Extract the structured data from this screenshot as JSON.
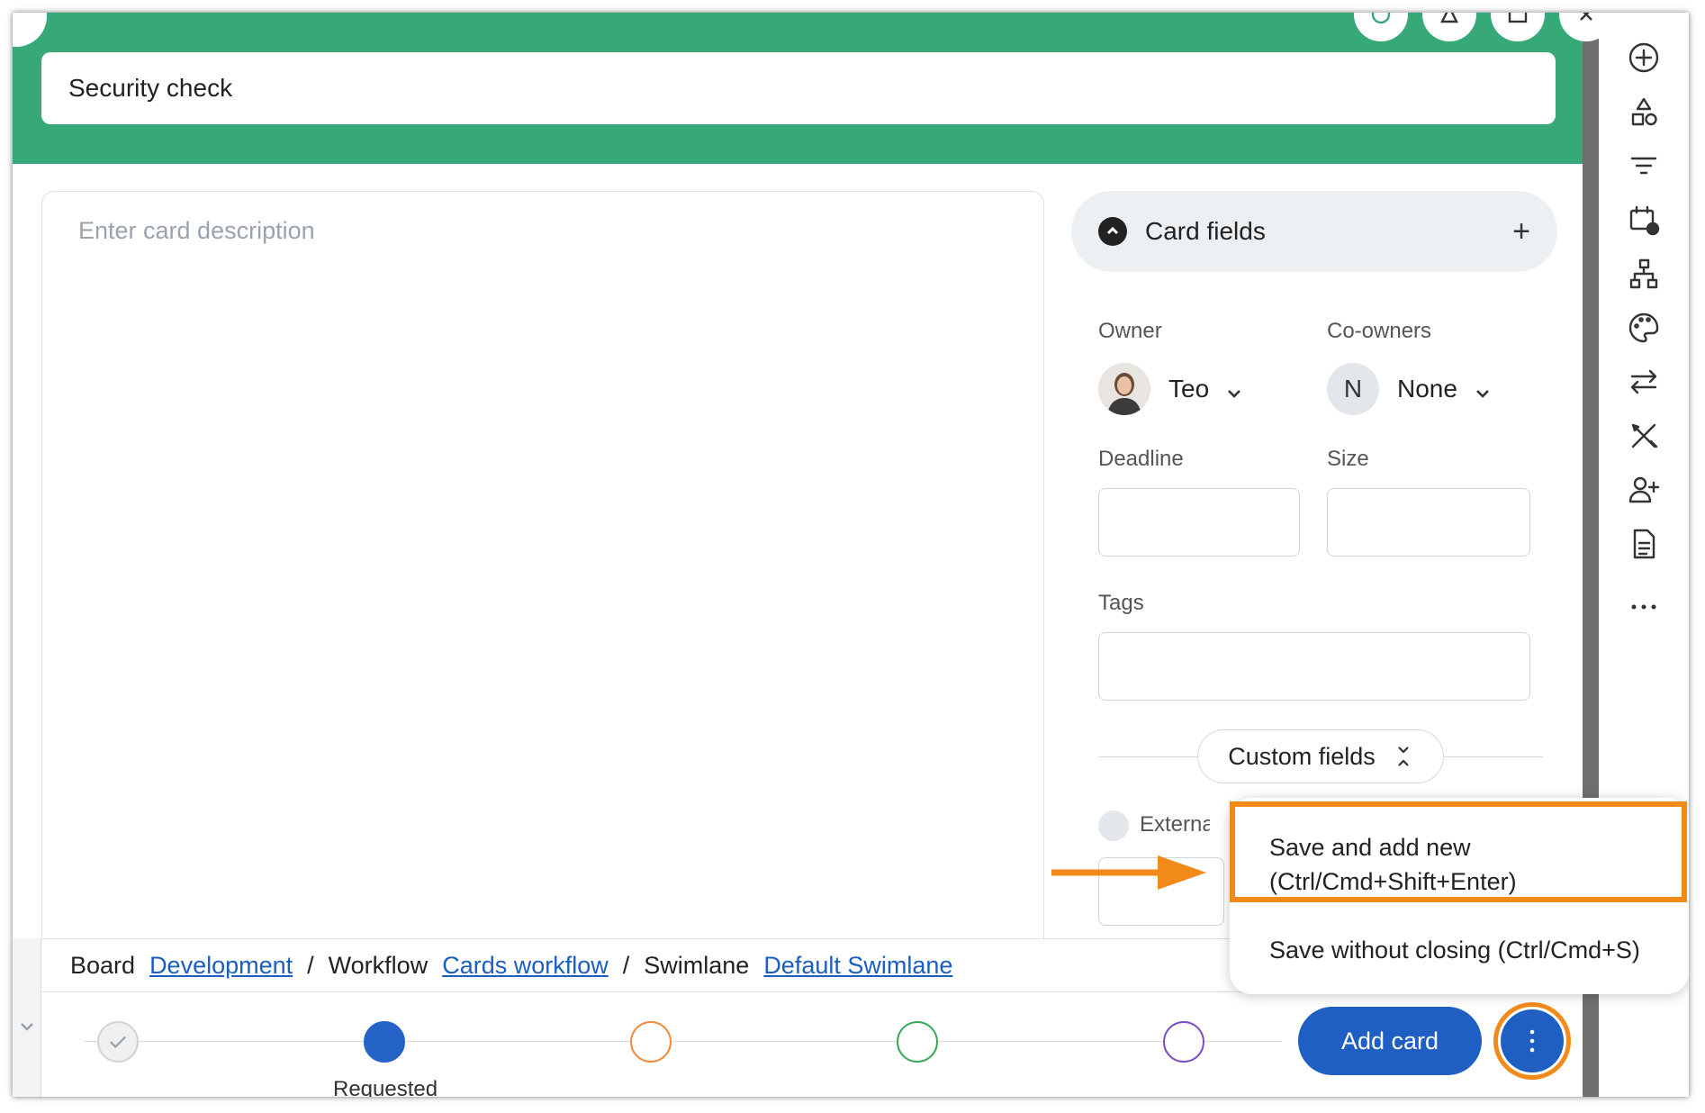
{
  "header": {
    "title_value": "Security check"
  },
  "description": {
    "placeholder": "Enter card description"
  },
  "card_fields": {
    "title": "Card fields",
    "add_symbol": "+",
    "owner_label": "Owner",
    "owner_name": "Teo",
    "coowners_label": "Co-owners",
    "coowners_initial": "N",
    "coowners_value": "None",
    "deadline_label": "Deadline",
    "size_label": "Size",
    "tags_label": "Tags",
    "custom_fields_label": "Custom fields",
    "external_label": "Externa"
  },
  "breadcrumb": {
    "board_label": "Board",
    "board_link": "Development",
    "sep1": "/",
    "workflow_label": "Workflow",
    "workflow_link": "Cards workflow",
    "sep2": "/",
    "swimlane_label": "Swimlane",
    "swimlane_link": "Default Swimlane"
  },
  "workflow": {
    "current_step_label": "Requested",
    "step_colors": [
      "#cfd4d9",
      "#2563c7",
      "#f28a3a",
      "#37a857",
      "#7a4fc4"
    ]
  },
  "actions": {
    "add_card": "Add card"
  },
  "menu": {
    "item1_line1": "Save and add new",
    "item1_line2": "(Ctrl/Cmd+Shift+Enter)",
    "item2": "Save without closing (Ctrl/Cmd+S)"
  },
  "colors": {
    "header_green": "#37a878",
    "primary_blue": "#1f5fc4",
    "highlight_orange": "#f28a1a"
  }
}
